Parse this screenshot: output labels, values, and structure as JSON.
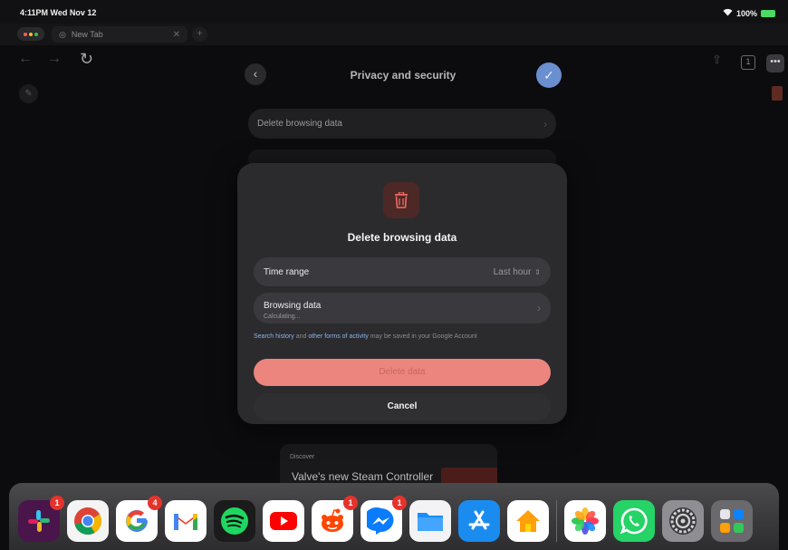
{
  "status": {
    "time": "4:11PM  Wed Nov 12",
    "battery": "100%"
  },
  "tabs": [
    {
      "label": "New Tab"
    }
  ],
  "toolbar": {
    "tab_count": "1"
  },
  "privacy_sheet": {
    "title": "Privacy and security",
    "rows": [
      {
        "label": "Delete browsing data"
      }
    ]
  },
  "discover": {
    "label": "Discover",
    "headline": "Valve's new Steam Controller"
  },
  "modal": {
    "title": "Delete browsing data",
    "time_range": {
      "label": "Time range",
      "value": "Last hour"
    },
    "browsing_data": {
      "label": "Browsing data",
      "status": "Calculating..."
    },
    "note": {
      "link1": "Search history",
      "and": " and ",
      "link2": "other forms of activity",
      "rest": " may be saved in your Google Account"
    },
    "delete_label": "Delete data",
    "cancel_label": "Cancel"
  },
  "dock": {
    "apps": [
      {
        "name": "Slack",
        "badge": "1"
      },
      {
        "name": "Chrome",
        "badge": ""
      },
      {
        "name": "Google",
        "badge": "4"
      },
      {
        "name": "Gmail",
        "badge": ""
      },
      {
        "name": "Spotify",
        "badge": ""
      },
      {
        "name": "YouTube",
        "badge": ""
      },
      {
        "name": "Reddit",
        "badge": "1"
      },
      {
        "name": "Messenger",
        "badge": "1"
      },
      {
        "name": "Files",
        "badge": ""
      },
      {
        "name": "App Store",
        "badge": ""
      },
      {
        "name": "Home",
        "badge": ""
      },
      {
        "name": "Photos",
        "badge": ""
      },
      {
        "name": "WhatsApp",
        "badge": ""
      },
      {
        "name": "Settings",
        "badge": ""
      },
      {
        "name": "App Library",
        "badge": ""
      }
    ]
  },
  "colors": {
    "accent": "#ec857e",
    "link": "#8fb2ee",
    "check": "#6a8fd0"
  }
}
